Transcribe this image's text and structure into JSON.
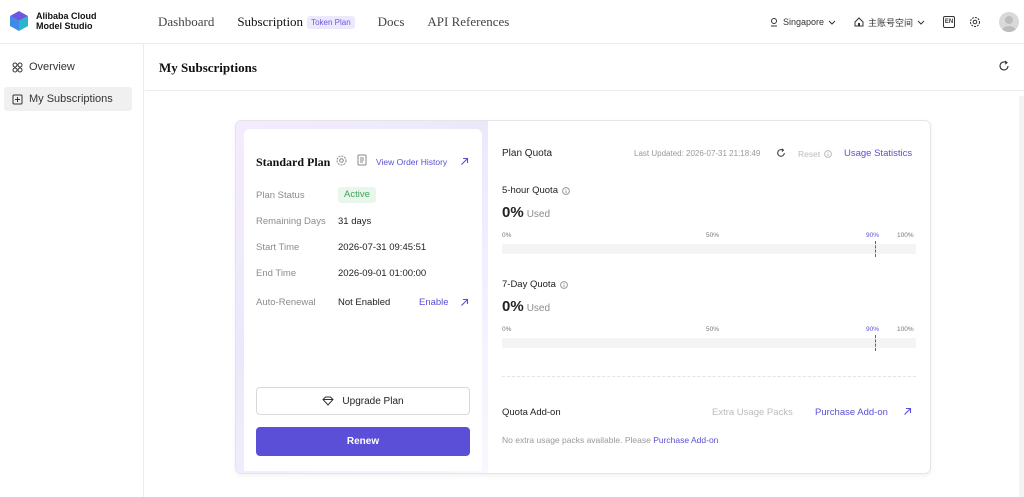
{
  "brand": {
    "line1": "Alibaba Cloud",
    "line2": "Model Studio"
  },
  "nav": {
    "items": [
      {
        "label": "Dashboard"
      },
      {
        "label": "Subscription",
        "badge": "Token Plan"
      },
      {
        "label": "Docs"
      },
      {
        "label": "API References"
      }
    ]
  },
  "topbar": {
    "region": "Singapore",
    "workspace": "主账号空间",
    "language": "EN"
  },
  "sidebar": {
    "items": [
      {
        "label": "Overview",
        "icon": "overview-grid-icon"
      },
      {
        "label": "My Subscriptions",
        "icon": "subscription-icon"
      }
    ]
  },
  "page": {
    "title": "My Subscriptions"
  },
  "plan": {
    "name": "Standard Plan",
    "order_history": "View Order History",
    "fields": {
      "status_label": "Plan Status",
      "status": "Active",
      "remaining_label": "Remaining Days",
      "remaining": "31 days",
      "start_label": "Start Time",
      "start": "2026-07-31 09:45:51",
      "end_label": "End Time",
      "end": "2026-09-01 01:00:00",
      "renewal_label": "Auto-Renewal",
      "renewal": "Not Enabled",
      "enable": "Enable"
    },
    "upgrade": "Upgrade Plan",
    "renew": "Renew"
  },
  "quota": {
    "title": "Plan Quota",
    "last_updated": "Last Updated: 2026-07-31 21:18:49",
    "reset": "Reset",
    "usage_stats": "Usage Statistics",
    "items": [
      {
        "label": "5-hour Quota",
        "percent": "0%",
        "used": "Used",
        "fill": 0,
        "marker": 0.9
      },
      {
        "label": "7-Day Quota",
        "percent": "0%",
        "used": "Used",
        "fill": 0,
        "marker": 0.9
      }
    ],
    "ticks": {
      "t0": "0%",
      "t50": "50%",
      "t90": "90%",
      "t100": "100%"
    }
  },
  "addon": {
    "title": "Quota Add-on",
    "extra": "Extra Usage Packs",
    "purchase": "Purchase Add-on",
    "note": "No extra usage packs available. Please ",
    "note_link": "Purchase Add-on"
  },
  "colors": {
    "accent": "#5a4fd6",
    "success": "#3ea55b"
  }
}
